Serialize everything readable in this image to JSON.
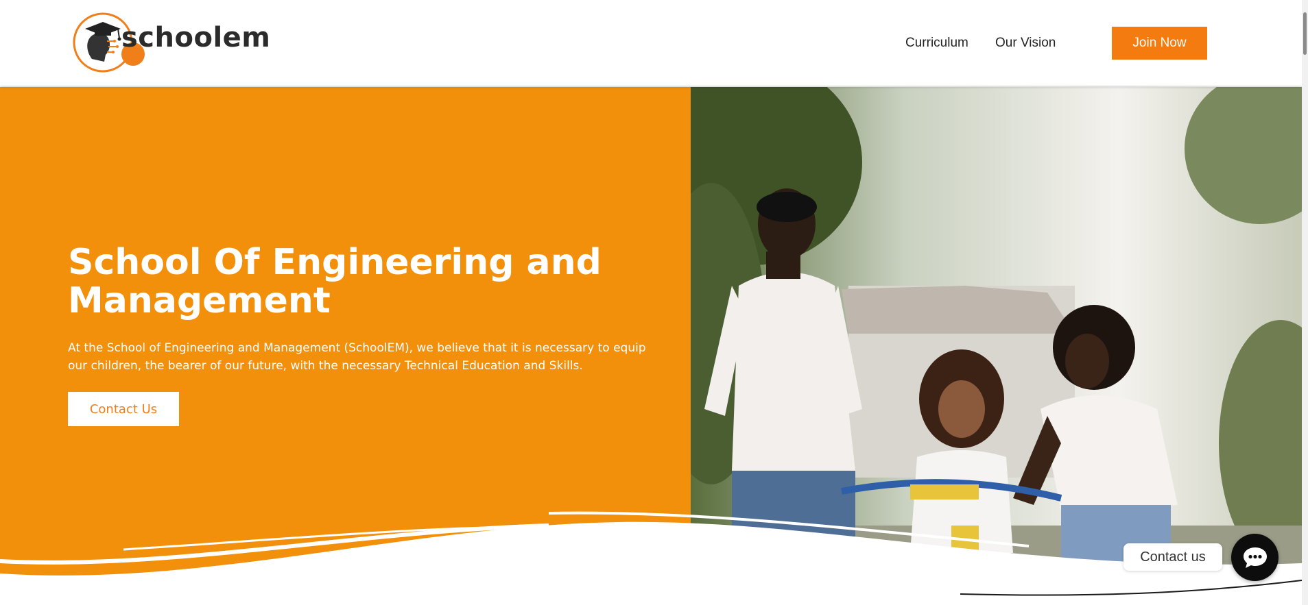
{
  "brand": {
    "logo_text": "schoolem",
    "accent_color": "#f2900c",
    "button_color": "#f37b10"
  },
  "nav": {
    "items": [
      {
        "label": "Curriculum"
      },
      {
        "label": "Our Vision"
      }
    ],
    "cta_label": "Join Now"
  },
  "hero": {
    "title": "School Of Engineering and Management",
    "description": "At the School of Engineering and Management (SchoolEM), we believe that it is necessary to equip our children, the bearer of our future, with the necessary Technical Education and Skills.",
    "button_label": "Contact Us",
    "photo_description_icon": "family-photo"
  },
  "chat": {
    "label": "Contact us",
    "icon": "chat-icon"
  }
}
